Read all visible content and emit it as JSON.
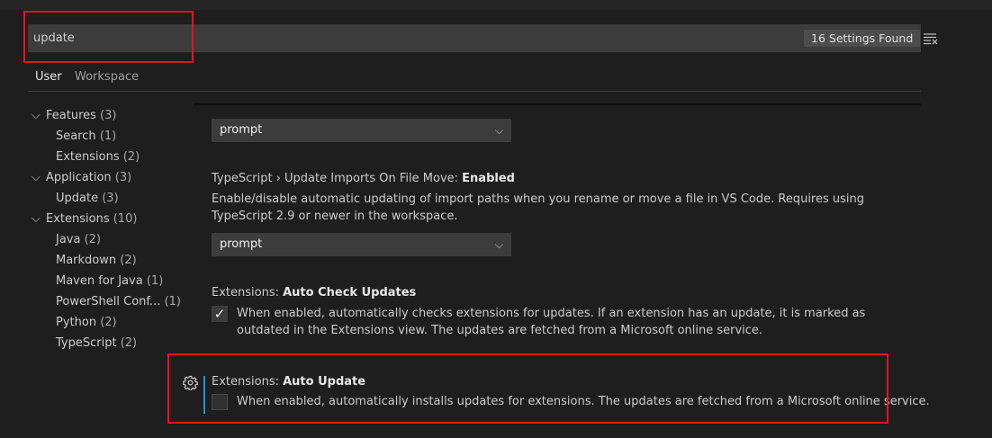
{
  "search": {
    "value": "update",
    "result_count": "16 Settings Found",
    "clear_icon": "clear-filter-icon"
  },
  "tabs": [
    {
      "label": "User",
      "active": true
    },
    {
      "label": "Workspace",
      "active": false
    }
  ],
  "toc": [
    {
      "label": "Features",
      "count": "(3)",
      "level": 0,
      "expanded": true
    },
    {
      "label": "Search",
      "count": "(1)",
      "level": 1
    },
    {
      "label": "Extensions",
      "count": "(2)",
      "level": 1
    },
    {
      "label": "Application",
      "count": "(3)",
      "level": 0,
      "expanded": true
    },
    {
      "label": "Update",
      "count": "(3)",
      "level": 1
    },
    {
      "label": "Extensions",
      "count": "(10)",
      "level": 0,
      "expanded": true
    },
    {
      "label": "Java",
      "count": "(2)",
      "level": 1
    },
    {
      "label": "Markdown",
      "count": "(2)",
      "level": 1
    },
    {
      "label": "Maven for Java",
      "count": "(1)",
      "level": 1
    },
    {
      "label": "PowerShell Conf...",
      "count": "(1)",
      "level": 1
    },
    {
      "label": "Python",
      "count": "(2)",
      "level": 1
    },
    {
      "label": "TypeScript",
      "count": "(2)",
      "level": 1
    }
  ],
  "settings": {
    "prev_select_value": "prompt",
    "ts_update_imports": {
      "category": "TypeScript › Update Imports On File Move: ",
      "name": "Enabled",
      "description": "Enable/disable automatic updating of import paths when you rename or move a file in VS Code. Requires using TypeScript 2.9 or newer in the workspace.",
      "value": "prompt"
    },
    "auto_check_updates": {
      "category": "Extensions: ",
      "name": "Auto Check Updates",
      "description": "When enabled, automatically checks extensions for updates. If an extension has an update, it is marked as outdated in the Extensions view. The updates are fetched from a Microsoft online service.",
      "checked": true
    },
    "auto_update": {
      "category": "Extensions: ",
      "name": "Auto Update",
      "description": "When enabled, automatically installs updates for extensions. The updates are fetched from a Microsoft online service.",
      "checked": false
    }
  },
  "colors": {
    "background": "#1e1e1e",
    "input_bg": "#3c3c3c",
    "highlight": "#e81123",
    "focus_accent": "#2b8fd6"
  }
}
